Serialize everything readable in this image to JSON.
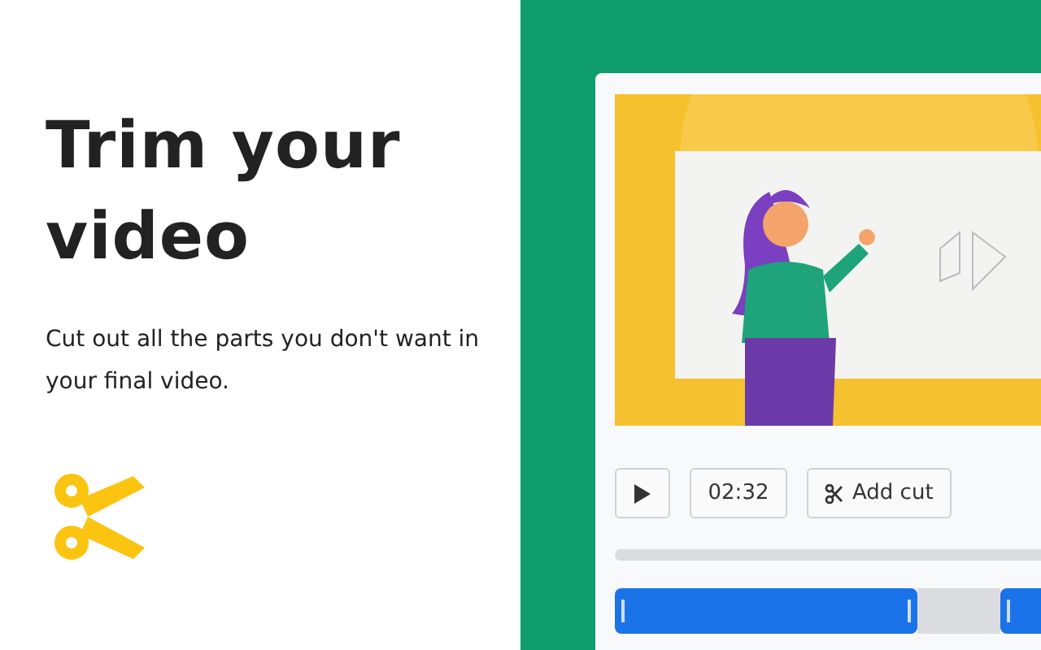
{
  "promo": {
    "headline": "Trim your video",
    "description": "Cut out all the parts you don't want in your final video."
  },
  "editor": {
    "time": "02:32",
    "add_cut_label": "Add cut",
    "segments": [
      {
        "kind": "kept"
      },
      {
        "kind": "cut"
      },
      {
        "kind": "kept"
      }
    ]
  }
}
